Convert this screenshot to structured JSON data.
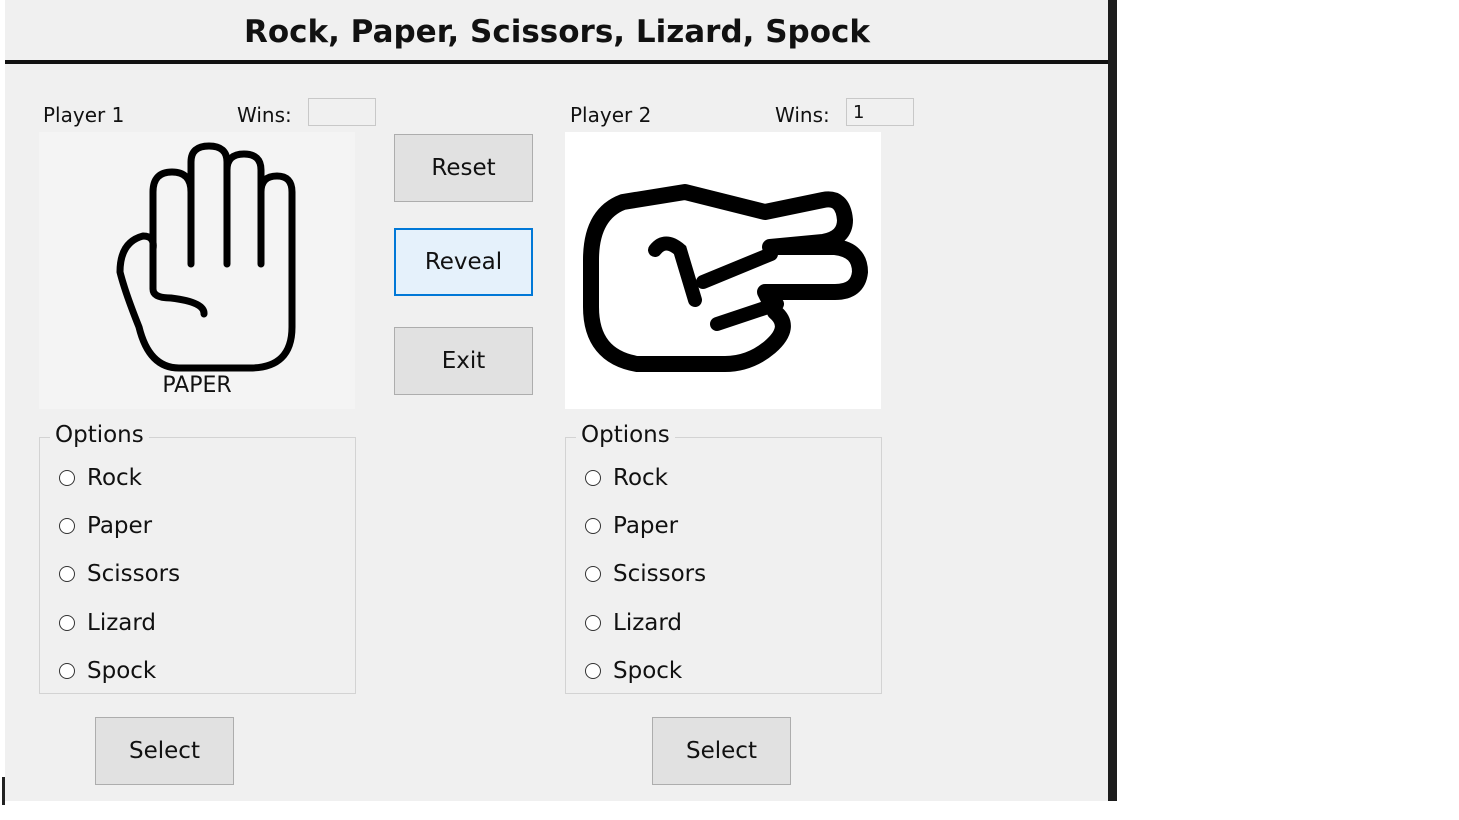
{
  "app": {
    "title": "Rock, Paper, Scissors, Lizard, Spock"
  },
  "player1": {
    "label": "Player 1",
    "wins_label": "Wins:",
    "wins_value": "",
    "image": {
      "icon": "paper-hand-icon",
      "caption": "PAPER",
      "background": "#f4f4f4"
    },
    "options_title": "Options",
    "options": [
      "Rock",
      "Paper",
      "Scissors",
      "Lizard",
      "Spock"
    ],
    "select_label": "Select"
  },
  "player2": {
    "label": "Player 2",
    "wins_label": "Wins:",
    "wins_value": "1",
    "image": {
      "icon": "scissors-hand-icon",
      "caption": "",
      "background": "#ffffff"
    },
    "options_title": "Options",
    "options": [
      "Rock",
      "Paper",
      "Scissors",
      "Lizard",
      "Spock"
    ],
    "select_label": "Select"
  },
  "controls": {
    "reset_label": "Reset",
    "reveal_label": "Reveal",
    "exit_label": "Exit"
  },
  "colors": {
    "focus_border": "#0078d7",
    "window_bg": "#f0f0f0"
  }
}
